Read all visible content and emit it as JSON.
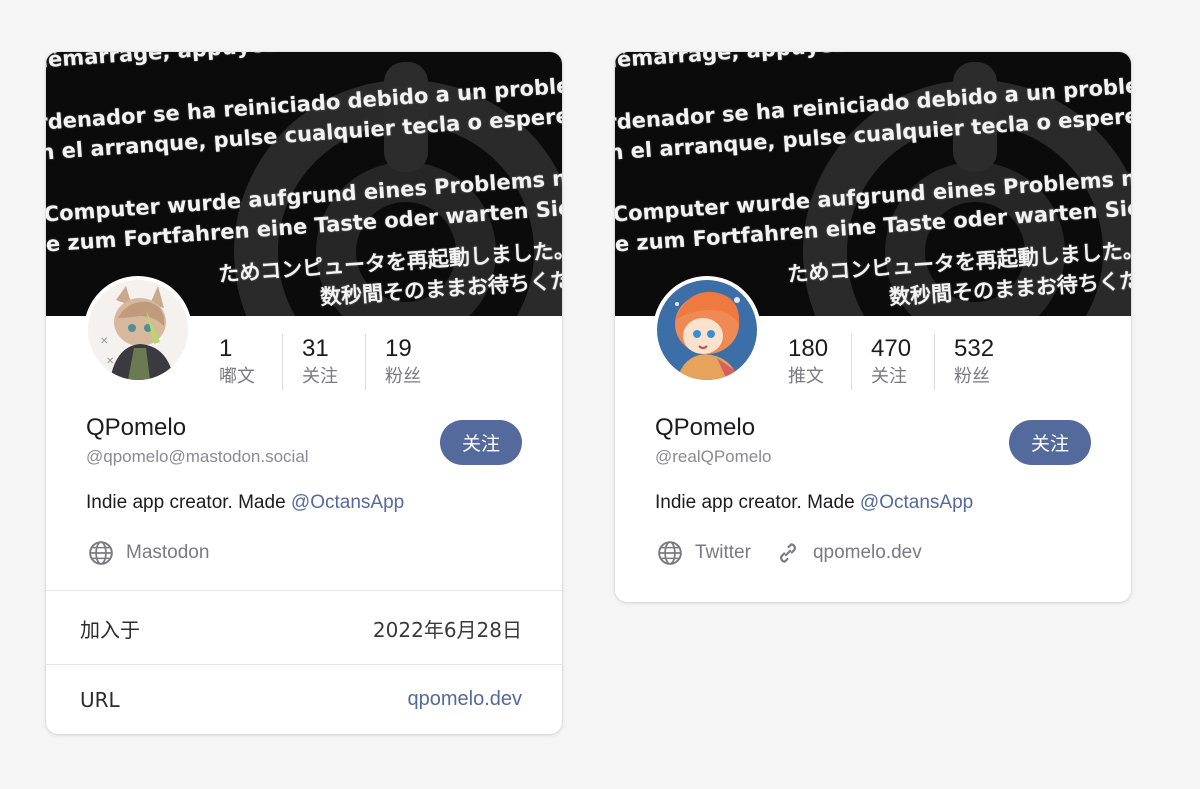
{
  "banner_lines": [
    "démarrage, appuyez sur une touche ou patientez quelques secondes",
    "rdenador se ha reiniciado debido a un problema. Para continuar",
    "n el arranque, pulse cualquier tecla o espere unos segundos",
    "Computer wurde aufgrund eines Problems neu gestartet",
    "e zum Fortfahren eine Taste oder warten Sie einige Sekunden",
    "ためコンピュータを再起動しました。このまま",
    "数秒間そのままお待ちください。"
  ],
  "cards": [
    {
      "stats": [
        {
          "num": "1",
          "label": "嘟文"
        },
        {
          "num": "31",
          "label": "关注"
        },
        {
          "num": "19",
          "label": "粉丝"
        }
      ],
      "name": "QPomelo",
      "handle": "@qpomelo@mastodon.social",
      "follow_label": "关注",
      "bio_text": "Indie app creator. Made ",
      "bio_mention": "@OctansApp",
      "links": [
        {
          "icon": "globe-icon",
          "text": "Mastodon"
        }
      ],
      "rows": [
        {
          "label": "加入于",
          "value": "2022年6月28日"
        },
        {
          "label": "URL",
          "value": "qpomelo.dev"
        }
      ]
    },
    {
      "stats": [
        {
          "num": "180",
          "label": "推文"
        },
        {
          "num": "470",
          "label": "关注"
        },
        {
          "num": "532",
          "label": "粉丝"
        }
      ],
      "name": "QPomelo",
      "handle": "@realQPomelo",
      "follow_label": "关注",
      "bio_text": "Indie app creator. Made ",
      "bio_mention": "@OctansApp",
      "links": [
        {
          "icon": "globe-icon",
          "text": "Twitter"
        },
        {
          "icon": "link-icon",
          "text": "qpomelo.dev"
        }
      ]
    }
  ],
  "colors": {
    "accent": "#546a9c",
    "background": "#f5f5f6",
    "banner_bg": "#0b0b0b"
  }
}
